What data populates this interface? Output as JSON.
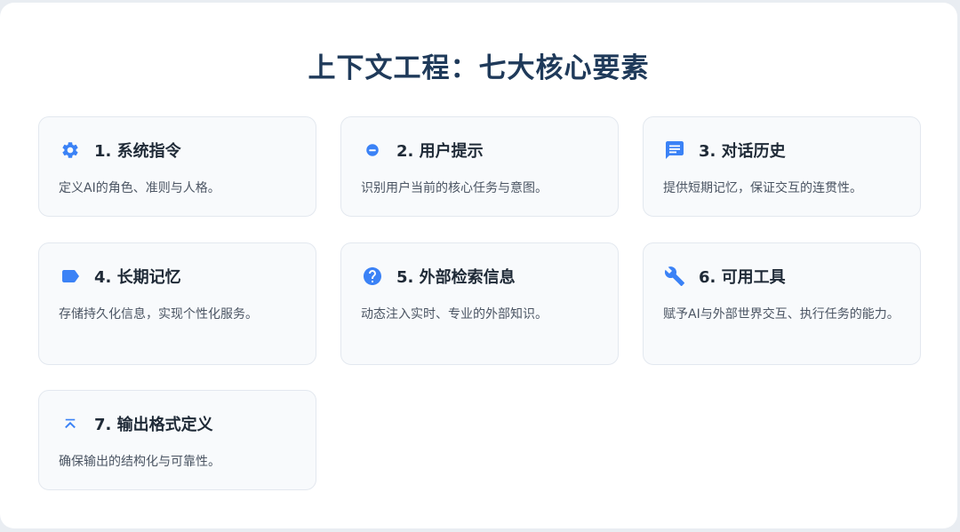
{
  "title": "上下文工程：七大核心要素",
  "accent_color": "#3b82f6",
  "cards": [
    {
      "icon": "gear-icon",
      "title": "1. 系统指令",
      "desc": "定义AI的角色、准则与人格。"
    },
    {
      "icon": "user-circle-icon",
      "title": "2. 用户提示",
      "desc": "识别用户当前的核心任务与意图。"
    },
    {
      "icon": "chat-bubble-icon",
      "title": "3. 对话历史",
      "desc": "提供短期记忆，保证交互的连贯性。"
    },
    {
      "icon": "tag-icon",
      "title": "4. 长期记忆",
      "desc": "存储持久化信息，实现个性化服务。"
    },
    {
      "icon": "question-circle-icon",
      "title": "5. 外部检索信息",
      "desc": "动态注入实时、专业的外部知识。"
    },
    {
      "icon": "wrench-icon",
      "title": "6. 可用工具",
      "desc": "赋予AI与外部世界交互、执行任务的能力。"
    },
    {
      "icon": "chevron-up-bar-icon",
      "title": "7. 输出格式定义",
      "desc": "确保输出的结构化与可靠性。"
    }
  ]
}
